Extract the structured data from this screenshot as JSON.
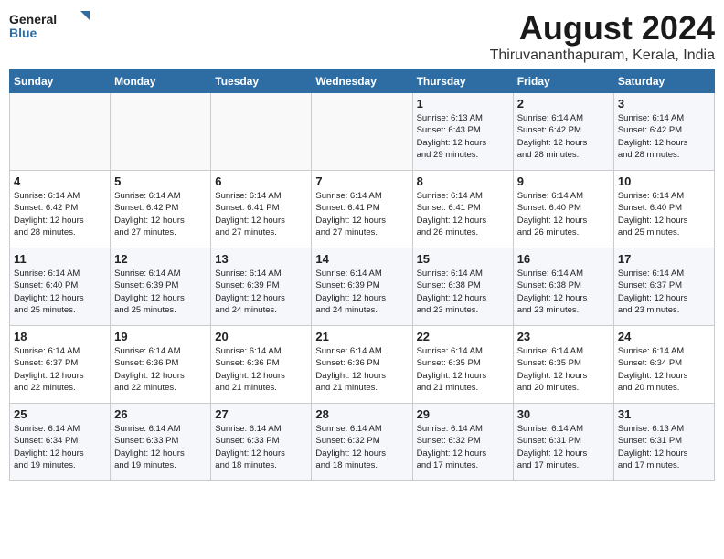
{
  "logo": {
    "line1": "General",
    "line2": "Blue"
  },
  "title": "August 2024",
  "subtitle": "Thiruvananthapuram, Kerala, India",
  "days_header": [
    "Sunday",
    "Monday",
    "Tuesday",
    "Wednesday",
    "Thursday",
    "Friday",
    "Saturday"
  ],
  "weeks": [
    [
      {
        "day": "",
        "detail": ""
      },
      {
        "day": "",
        "detail": ""
      },
      {
        "day": "",
        "detail": ""
      },
      {
        "day": "",
        "detail": ""
      },
      {
        "day": "1",
        "detail": "Sunrise: 6:13 AM\nSunset: 6:43 PM\nDaylight: 12 hours\nand 29 minutes."
      },
      {
        "day": "2",
        "detail": "Sunrise: 6:14 AM\nSunset: 6:42 PM\nDaylight: 12 hours\nand 28 minutes."
      },
      {
        "day": "3",
        "detail": "Sunrise: 6:14 AM\nSunset: 6:42 PM\nDaylight: 12 hours\nand 28 minutes."
      }
    ],
    [
      {
        "day": "4",
        "detail": "Sunrise: 6:14 AM\nSunset: 6:42 PM\nDaylight: 12 hours\nand 28 minutes."
      },
      {
        "day": "5",
        "detail": "Sunrise: 6:14 AM\nSunset: 6:42 PM\nDaylight: 12 hours\nand 27 minutes."
      },
      {
        "day": "6",
        "detail": "Sunrise: 6:14 AM\nSunset: 6:41 PM\nDaylight: 12 hours\nand 27 minutes."
      },
      {
        "day": "7",
        "detail": "Sunrise: 6:14 AM\nSunset: 6:41 PM\nDaylight: 12 hours\nand 27 minutes."
      },
      {
        "day": "8",
        "detail": "Sunrise: 6:14 AM\nSunset: 6:41 PM\nDaylight: 12 hours\nand 26 minutes."
      },
      {
        "day": "9",
        "detail": "Sunrise: 6:14 AM\nSunset: 6:40 PM\nDaylight: 12 hours\nand 26 minutes."
      },
      {
        "day": "10",
        "detail": "Sunrise: 6:14 AM\nSunset: 6:40 PM\nDaylight: 12 hours\nand 25 minutes."
      }
    ],
    [
      {
        "day": "11",
        "detail": "Sunrise: 6:14 AM\nSunset: 6:40 PM\nDaylight: 12 hours\nand 25 minutes."
      },
      {
        "day": "12",
        "detail": "Sunrise: 6:14 AM\nSunset: 6:39 PM\nDaylight: 12 hours\nand 25 minutes."
      },
      {
        "day": "13",
        "detail": "Sunrise: 6:14 AM\nSunset: 6:39 PM\nDaylight: 12 hours\nand 24 minutes."
      },
      {
        "day": "14",
        "detail": "Sunrise: 6:14 AM\nSunset: 6:39 PM\nDaylight: 12 hours\nand 24 minutes."
      },
      {
        "day": "15",
        "detail": "Sunrise: 6:14 AM\nSunset: 6:38 PM\nDaylight: 12 hours\nand 23 minutes."
      },
      {
        "day": "16",
        "detail": "Sunrise: 6:14 AM\nSunset: 6:38 PM\nDaylight: 12 hours\nand 23 minutes."
      },
      {
        "day": "17",
        "detail": "Sunrise: 6:14 AM\nSunset: 6:37 PM\nDaylight: 12 hours\nand 23 minutes."
      }
    ],
    [
      {
        "day": "18",
        "detail": "Sunrise: 6:14 AM\nSunset: 6:37 PM\nDaylight: 12 hours\nand 22 minutes."
      },
      {
        "day": "19",
        "detail": "Sunrise: 6:14 AM\nSunset: 6:36 PM\nDaylight: 12 hours\nand 22 minutes."
      },
      {
        "day": "20",
        "detail": "Sunrise: 6:14 AM\nSunset: 6:36 PM\nDaylight: 12 hours\nand 21 minutes."
      },
      {
        "day": "21",
        "detail": "Sunrise: 6:14 AM\nSunset: 6:36 PM\nDaylight: 12 hours\nand 21 minutes."
      },
      {
        "day": "22",
        "detail": "Sunrise: 6:14 AM\nSunset: 6:35 PM\nDaylight: 12 hours\nand 21 minutes."
      },
      {
        "day": "23",
        "detail": "Sunrise: 6:14 AM\nSunset: 6:35 PM\nDaylight: 12 hours\nand 20 minutes."
      },
      {
        "day": "24",
        "detail": "Sunrise: 6:14 AM\nSunset: 6:34 PM\nDaylight: 12 hours\nand 20 minutes."
      }
    ],
    [
      {
        "day": "25",
        "detail": "Sunrise: 6:14 AM\nSunset: 6:34 PM\nDaylight: 12 hours\nand 19 minutes."
      },
      {
        "day": "26",
        "detail": "Sunrise: 6:14 AM\nSunset: 6:33 PM\nDaylight: 12 hours\nand 19 minutes."
      },
      {
        "day": "27",
        "detail": "Sunrise: 6:14 AM\nSunset: 6:33 PM\nDaylight: 12 hours\nand 18 minutes."
      },
      {
        "day": "28",
        "detail": "Sunrise: 6:14 AM\nSunset: 6:32 PM\nDaylight: 12 hours\nand 18 minutes."
      },
      {
        "day": "29",
        "detail": "Sunrise: 6:14 AM\nSunset: 6:32 PM\nDaylight: 12 hours\nand 17 minutes."
      },
      {
        "day": "30",
        "detail": "Sunrise: 6:14 AM\nSunset: 6:31 PM\nDaylight: 12 hours\nand 17 minutes."
      },
      {
        "day": "31",
        "detail": "Sunrise: 6:13 AM\nSunset: 6:31 PM\nDaylight: 12 hours\nand 17 minutes."
      }
    ]
  ]
}
